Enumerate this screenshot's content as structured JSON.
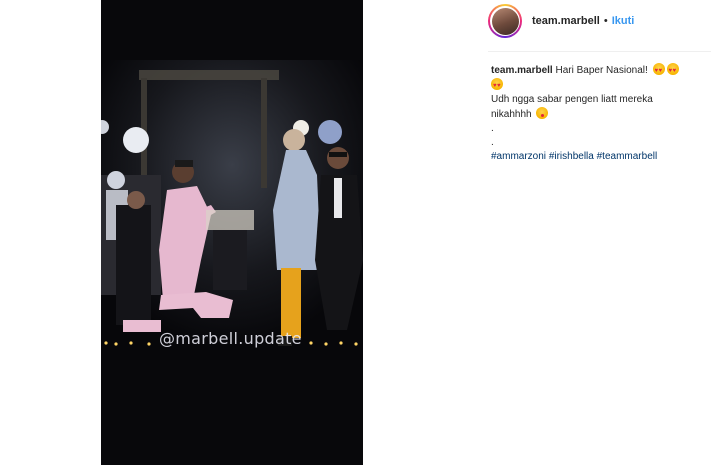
{
  "post": {
    "watermark": "@marbell.update"
  },
  "header": {
    "username": "team.marbell",
    "separator": "•",
    "follow_label": "Ikuti"
  },
  "caption": {
    "username": "team.marbell",
    "line1_text": "Hari Baper Nasional!",
    "line2_text": "Udh ngga sabar pengen liatt mereka",
    "line3_text": "nikahhhh",
    "dot1": ".",
    "dot2": ".",
    "hashtags": [
      "#ammarzoni",
      "#irishbella",
      "#teammarbell"
    ],
    "emojis": [
      "heart-eyes-emoji",
      "heart-eyes-emoji",
      "heart-eyes-emoji",
      "yum-emoji"
    ]
  },
  "colors": {
    "link": "#3897f0",
    "hashtag": "#003569",
    "text": "#262626"
  }
}
